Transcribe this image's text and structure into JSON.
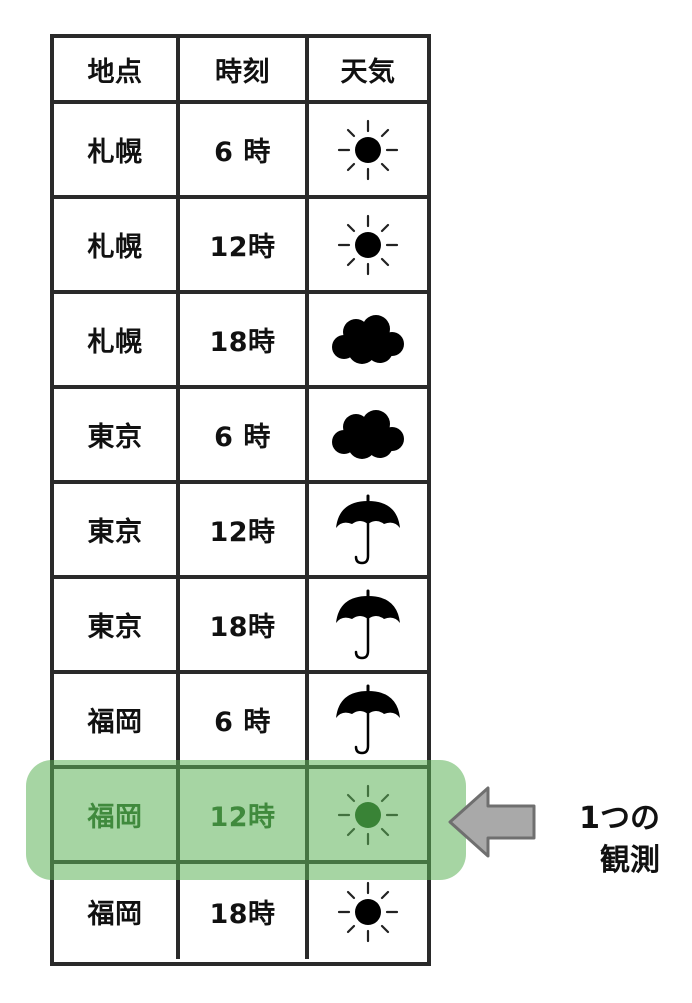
{
  "header": {
    "location": "地点",
    "time": "時刻",
    "weather": "天気"
  },
  "rows": [
    {
      "location": "札幌",
      "time": "6 時",
      "weather_icon": "sun-icon"
    },
    {
      "location": "札幌",
      "time": "12時",
      "weather_icon": "sun-icon"
    },
    {
      "location": "札幌",
      "time": "18時",
      "weather_icon": "cloud-icon"
    },
    {
      "location": "東京",
      "time": "6 時",
      "weather_icon": "cloud-icon"
    },
    {
      "location": "東京",
      "time": "12時",
      "weather_icon": "umbrella-icon"
    },
    {
      "location": "東京",
      "time": "18時",
      "weather_icon": "umbrella-icon"
    },
    {
      "location": "福岡",
      "time": "6 時",
      "weather_icon": "umbrella-icon"
    },
    {
      "location": "福岡",
      "time": "12時",
      "weather_icon": "sun-icon",
      "highlighted": true
    },
    {
      "location": "福岡",
      "time": "18時",
      "weather_icon": "sun-icon"
    }
  ],
  "annotation": {
    "line1": "1つの",
    "line2": "観測"
  },
  "colors": {
    "highlight": "#5db258",
    "highlight_text": "#1e5a1e",
    "arrow_fill": "#a9a9a9",
    "arrow_stroke": "#6f6f6f",
    "grid": "#2a2a2a"
  }
}
